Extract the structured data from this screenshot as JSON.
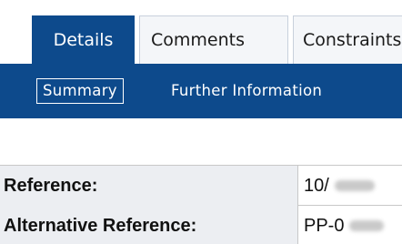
{
  "tabs": [
    {
      "label": "Details",
      "active": true
    },
    {
      "label": "Comments",
      "active": false
    },
    {
      "label": "Constraints",
      "active": false
    }
  ],
  "subnav": {
    "summary_label": "Summary",
    "further_label": "Further Information"
  },
  "details": {
    "rows": [
      {
        "label": "Reference:",
        "value": "10/"
      },
      {
        "label": "Alternative Reference:",
        "value": "PP-0"
      }
    ]
  },
  "colors": {
    "accent": "#0d4a8c",
    "label_bg": "#eceef2",
    "border": "#c8c8c8"
  }
}
